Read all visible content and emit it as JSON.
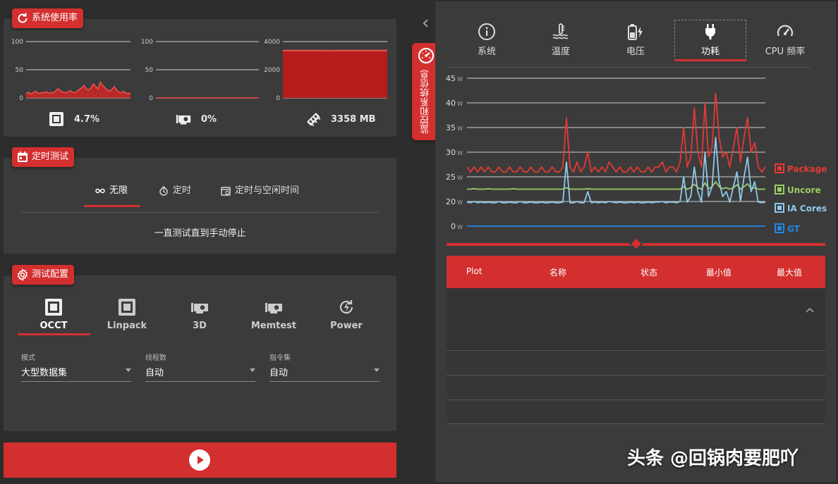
{
  "usage": {
    "title": "系统使用率",
    "cpu_chart": {
      "ticks": [
        "100",
        "50",
        "0"
      ],
      "max": 100,
      "values": [
        8,
        10,
        7,
        9,
        12,
        9,
        8,
        10,
        9,
        11,
        8,
        10,
        9,
        14,
        16,
        12,
        10,
        9,
        11,
        13,
        10,
        9,
        12,
        15,
        18,
        22,
        16,
        14,
        18,
        25,
        20,
        16,
        28,
        22,
        18,
        14,
        12,
        15,
        20,
        14,
        10,
        9,
        12,
        8,
        9,
        7
      ]
    },
    "gpu_chart": {
      "ticks": [
        "100",
        "50",
        "0"
      ],
      "max": 100,
      "values": [
        0,
        0,
        0,
        0,
        0,
        0,
        0,
        0,
        0,
        0,
        0,
        0,
        0,
        0,
        0,
        0,
        0,
        0,
        0,
        0
      ]
    },
    "mem_chart": {
      "ticks": [
        "4000",
        "2000",
        "0"
      ],
      "max": 4000,
      "values": [
        3358,
        3358,
        3360,
        3358,
        3356,
        3358,
        3358,
        3358,
        3358,
        3358
      ]
    },
    "cpu_value": "4.7%",
    "gpu_value": "0%",
    "mem_value": "3358 MB"
  },
  "timed": {
    "title": "定时测试",
    "tabs": [
      "无限",
      "定时",
      "定时与空闲时间"
    ],
    "description": "一直测试直到手动停止"
  },
  "config": {
    "title": "测试配置",
    "tabs": [
      "OCCT",
      "Linpack",
      "3D",
      "Memtest",
      "Power"
    ],
    "fields": [
      {
        "label": "模式",
        "value": "大型数据集"
      },
      {
        "label": "线程数",
        "value": "自动"
      },
      {
        "label": "指令集",
        "value": "自动"
      }
    ]
  },
  "monitor": {
    "vertical_tab": "监控和系统信息",
    "tabs": [
      "系统",
      "温度",
      "电压",
      "功耗",
      "CPU 频率"
    ],
    "active_tab": "功耗",
    "table_headers": [
      "Plot",
      "名称",
      "状态",
      "最小值",
      "最大值"
    ]
  },
  "chart_data": {
    "type": "line",
    "y_ticks": [
      "45",
      "40",
      "35",
      "30",
      "25",
      "20",
      "0"
    ],
    "y_unit": "W",
    "ylim": [
      0,
      45
    ],
    "grid": true,
    "legend_placement": "right",
    "series": [
      {
        "name": "Package",
        "color": "#e53935",
        "values": [
          27,
          26,
          27,
          26,
          27,
          26,
          27,
          26,
          26,
          27,
          26,
          26,
          27,
          26,
          26,
          27,
          26,
          26,
          27,
          26,
          26,
          27,
          26,
          26,
          27,
          26,
          26,
          27,
          37,
          27,
          26,
          28,
          26,
          27,
          30,
          26,
          27,
          26,
          27,
          26,
          28,
          27,
          26,
          27,
          26,
          26,
          27,
          26,
          27,
          26,
          26,
          27,
          26,
          27,
          27,
          28,
          26,
          27,
          27,
          26,
          28,
          35,
          27,
          29,
          39,
          30,
          27,
          40,
          29,
          31,
          42,
          33,
          29,
          30,
          27,
          31,
          35,
          28,
          33,
          37,
          30,
          32,
          27,
          26,
          27
        ]
      },
      {
        "name": "Uncore",
        "color": "#9ccc65",
        "values": [
          22.5,
          22.5,
          22.6,
          22.5,
          22.5,
          22.5,
          22.6,
          22.5,
          22.5,
          22.5,
          22.5,
          22.5,
          22.5,
          22.6,
          22.5,
          22.5,
          22.5,
          22.5,
          22.5,
          22.5,
          22.5,
          22.5,
          22.5,
          22.5,
          22.5,
          22.5,
          22.5,
          22.5,
          22.8,
          22.5,
          22.5,
          22.5,
          22.5,
          22.5,
          22.6,
          22.5,
          22.5,
          22.5,
          22.5,
          22.5,
          22.5,
          22.5,
          22.5,
          22.5,
          22.5,
          22.5,
          22.5,
          22.5,
          22.5,
          22.5,
          22.5,
          22.5,
          22.5,
          22.5,
          22.5,
          22.5,
          22.5,
          22.5,
          22.5,
          22.5,
          22.5,
          23,
          22.5,
          22.8,
          23.5,
          22.8,
          22.5,
          23.8,
          22.6,
          23,
          24,
          23,
          22.6,
          22.8,
          22.5,
          22.8,
          23.4,
          22.5,
          23,
          23.6,
          22.6,
          22.8,
          22.5,
          22.5,
          22.5
        ]
      },
      {
        "name": "IA Cores",
        "color": "#8ec9ea",
        "values": [
          19.5,
          19,
          20,
          19,
          19.5,
          19,
          19.5,
          19,
          19,
          20,
          19,
          19,
          19.5,
          19,
          19,
          20,
          19,
          19,
          19.5,
          19,
          19,
          19.5,
          19,
          19,
          19.5,
          19,
          19,
          19.5,
          28,
          19,
          19,
          20,
          19,
          19,
          22,
          19,
          19.5,
          19,
          19.5,
          19,
          20,
          19.5,
          19,
          19.5,
          19,
          19,
          19.5,
          19,
          19.5,
          19,
          19,
          19.5,
          19,
          19.5,
          19.5,
          20,
          19,
          19.5,
          19.5,
          19,
          20,
          25,
          19.5,
          21,
          27,
          22,
          19.5,
          30,
          21,
          23,
          33,
          24,
          21,
          22,
          19.5,
          23,
          26,
          20,
          25,
          29,
          22,
          24,
          19.5,
          19,
          19.5
        ]
      },
      {
        "name": "GT",
        "color": "#1e88e5",
        "values": [
          0,
          0,
          0,
          0,
          0,
          0,
          0,
          0,
          0,
          0,
          0,
          0,
          0,
          0,
          0,
          0,
          0,
          0,
          0,
          0,
          0,
          0,
          0,
          0,
          0,
          0,
          0,
          0,
          0,
          0,
          0,
          0,
          0,
          0,
          0,
          0,
          0,
          0,
          0,
          0,
          0,
          0,
          0,
          0,
          0,
          0,
          0,
          0,
          0,
          0,
          0,
          0,
          0,
          0,
          0,
          0,
          0,
          0,
          0,
          0,
          0,
          0,
          0,
          0,
          0,
          0,
          0,
          0,
          0,
          0,
          0,
          0,
          0,
          0,
          0,
          0,
          0,
          0,
          0,
          0,
          0,
          0,
          0,
          0,
          0
        ]
      }
    ]
  },
  "watermark": "头条 @回锅肉要肥吖"
}
